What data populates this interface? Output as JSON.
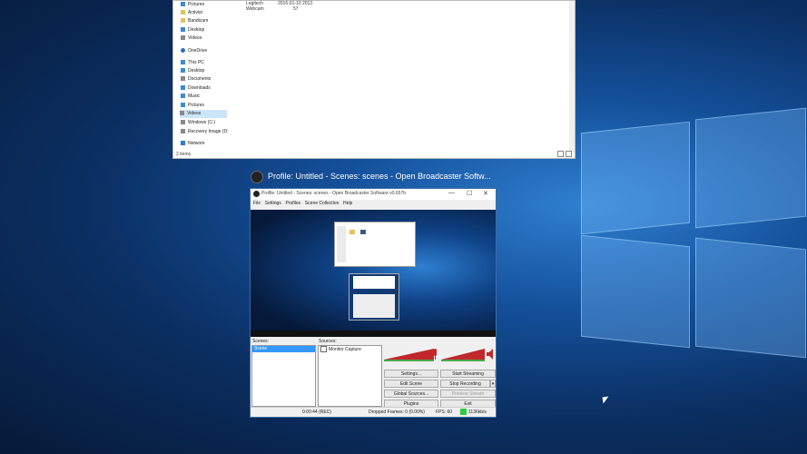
{
  "explorer": {
    "nav_items": [
      "Pictures",
      "Activist",
      "Bandicam",
      "Desktop",
      "Videos",
      "OneDrive",
      "This PC",
      "Desktop",
      "Documents",
      "Downloads",
      "Music",
      "Pictures",
      "Videos",
      "Windows (C:)",
      "Recovery Image (D:",
      "Network"
    ],
    "file_name_1": "Logitech",
    "file_name_2": "Webcam",
    "file_date_1": "2016-01-10 2012:",
    "file_date_2": "57",
    "status": "2 items"
  },
  "taskview": {
    "label": "Profile: Untitled - Scenes: scenes - Open Broadcaster Softw..."
  },
  "obs": {
    "title": "Profile: Untitled - Scenes: scenes - Open Broadcaster Software v0.657b",
    "controls": {
      "minimize": "—",
      "maximize": "☐",
      "close": "✕"
    },
    "menu": [
      "File",
      "Settings",
      "Profiles",
      "Scene Collection",
      "Help"
    ],
    "scenes_label": "Scenes:",
    "sources_label": "Sources:",
    "scenes": [
      "Scene"
    ],
    "sources": [
      "Monitor Capture"
    ],
    "buttons": {
      "settings": "Settings...",
      "start_streaming": "Start Streaming",
      "edit_scene": "Edit Scene",
      "stop_recording": "Stop Recording",
      "global_sources": "Global Sources...",
      "preview_stream": "Preview Stream",
      "plugins": "Plugins",
      "exit": "Exit"
    },
    "status": {
      "time": "0:00:44 (REC)",
      "dropped": "Dropped Frames: 0 (0.00%)",
      "fps": "FPS: 60",
      "bitrate": "1136kb/s"
    }
  },
  "colors": {
    "accent": "#3399ff",
    "meter_red": "#c0282c",
    "bitrate_green": "#2ecc40"
  }
}
